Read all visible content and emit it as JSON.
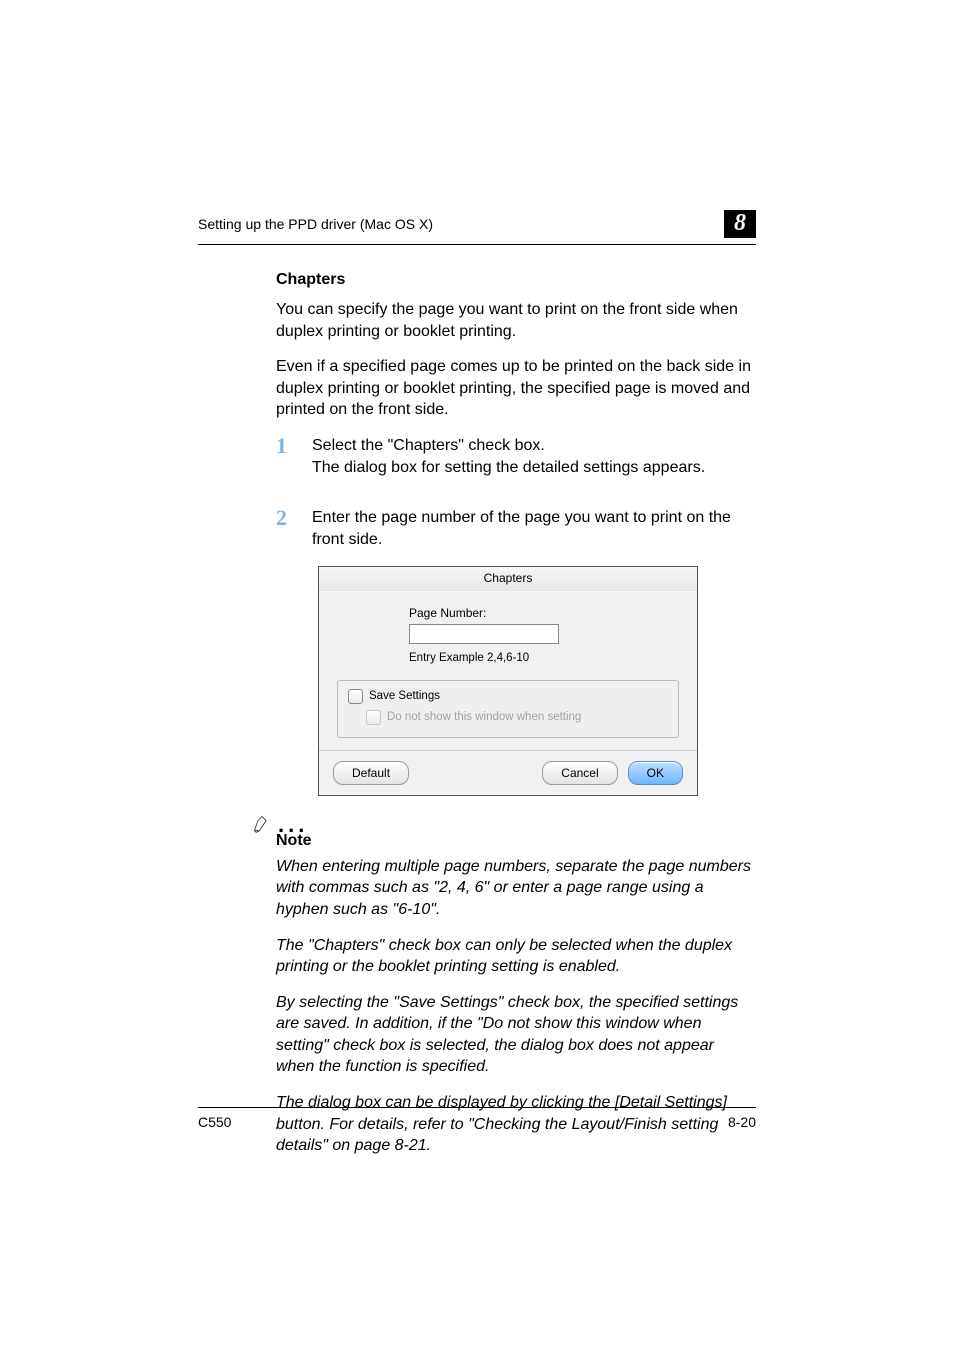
{
  "header": {
    "running_title": "Setting up the PPD driver (Mac OS X)",
    "chapter_number": "8"
  },
  "section": {
    "title": "Chapters",
    "intro1": "You can specify the page you want to print on the front side when duplex printing or booklet printing.",
    "intro2": "Even if a specified page comes up to be printed on the back side in duplex printing or booklet printing, the specified page is moved and printed on the front side."
  },
  "steps": [
    {
      "number": "1",
      "text": "Select the \"Chapters\" check box.",
      "sub": "The dialog box for setting the detailed settings appears."
    },
    {
      "number": "2",
      "text": "Enter the page number of the page you want to print on the front side."
    }
  ],
  "dialog": {
    "title": "Chapters",
    "page_number_label": "Page Number:",
    "page_number_value": "",
    "entry_example": "Entry Example 2,4,6-10",
    "save_settings_label": "Save Settings",
    "do_not_show_label": "Do not show this window when setting",
    "default_button": "Default",
    "cancel_button": "Cancel",
    "ok_button": "OK"
  },
  "note": {
    "label": "Note",
    "p1": "When entering multiple page numbers, separate the page numbers with commas such as \"2, 4, 6\" or enter a page range using a hyphen such as \"6-10\".",
    "p2": "The \"Chapters\" check box can only be selected when the duplex printing or the booklet printing setting is enabled.",
    "p3": "By selecting the \"Save Settings\" check box, the specified settings are saved. In addition, if the \"Do not show this window when setting\" check box is selected, the dialog box does not appear when the function is specified.",
    "p4": "The dialog box can be displayed by clicking the [Detail Settings] button. For details, refer to \"Checking the Layout/Finish setting details\" on page 8-21."
  },
  "footer": {
    "model": "C550",
    "page": "8-20"
  }
}
